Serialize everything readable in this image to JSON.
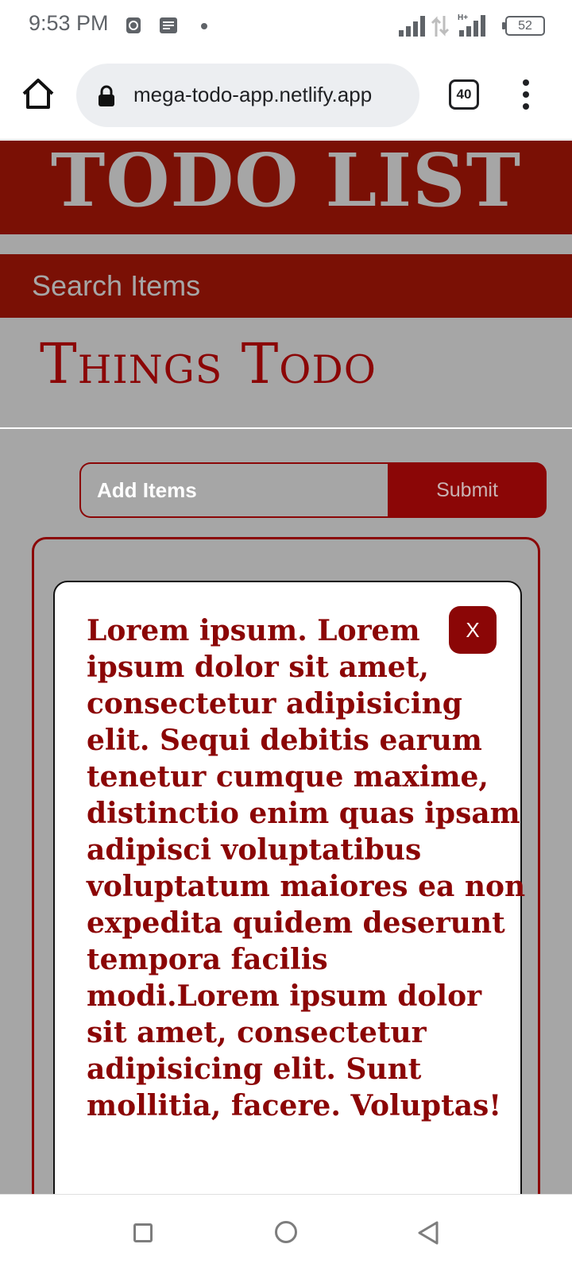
{
  "status_bar": {
    "time": "9:53 PM",
    "battery": "52",
    "icons": [
      "notification-app-icon",
      "message-icon",
      "signal-icon",
      "data-transfer-icon",
      "signal-hplus-icon",
      "battery-icon"
    ]
  },
  "browser": {
    "url": "mega-todo-app.netlify.app",
    "tab_count": "40"
  },
  "page": {
    "title": "TODO LIST",
    "search_placeholder": "Search Items",
    "section_title": "Things Todo",
    "add_placeholder": "Add Items",
    "submit_label": "Submit",
    "todos": [
      {
        "text": "Lorem ipsum. Lorem ipsum dolor sit amet, consectetur adipisicing elit. Sequi debitis earum tenetur cumque maxime, distinctio enim quas ipsam adipisci voluptatibus voluptatum maiores ea non expedita quidem deserunt tempora facilis modi.Lorem ipsum dolor sit amet, consectetur adipisicing elit. Sunt mollitia, facere. Voluptas!",
        "delete_label": "X"
      }
    ]
  },
  "colors": {
    "brand_dark_red": "#7a1005",
    "accent_red": "#8b0606",
    "page_gray": "#a6a6a6"
  }
}
